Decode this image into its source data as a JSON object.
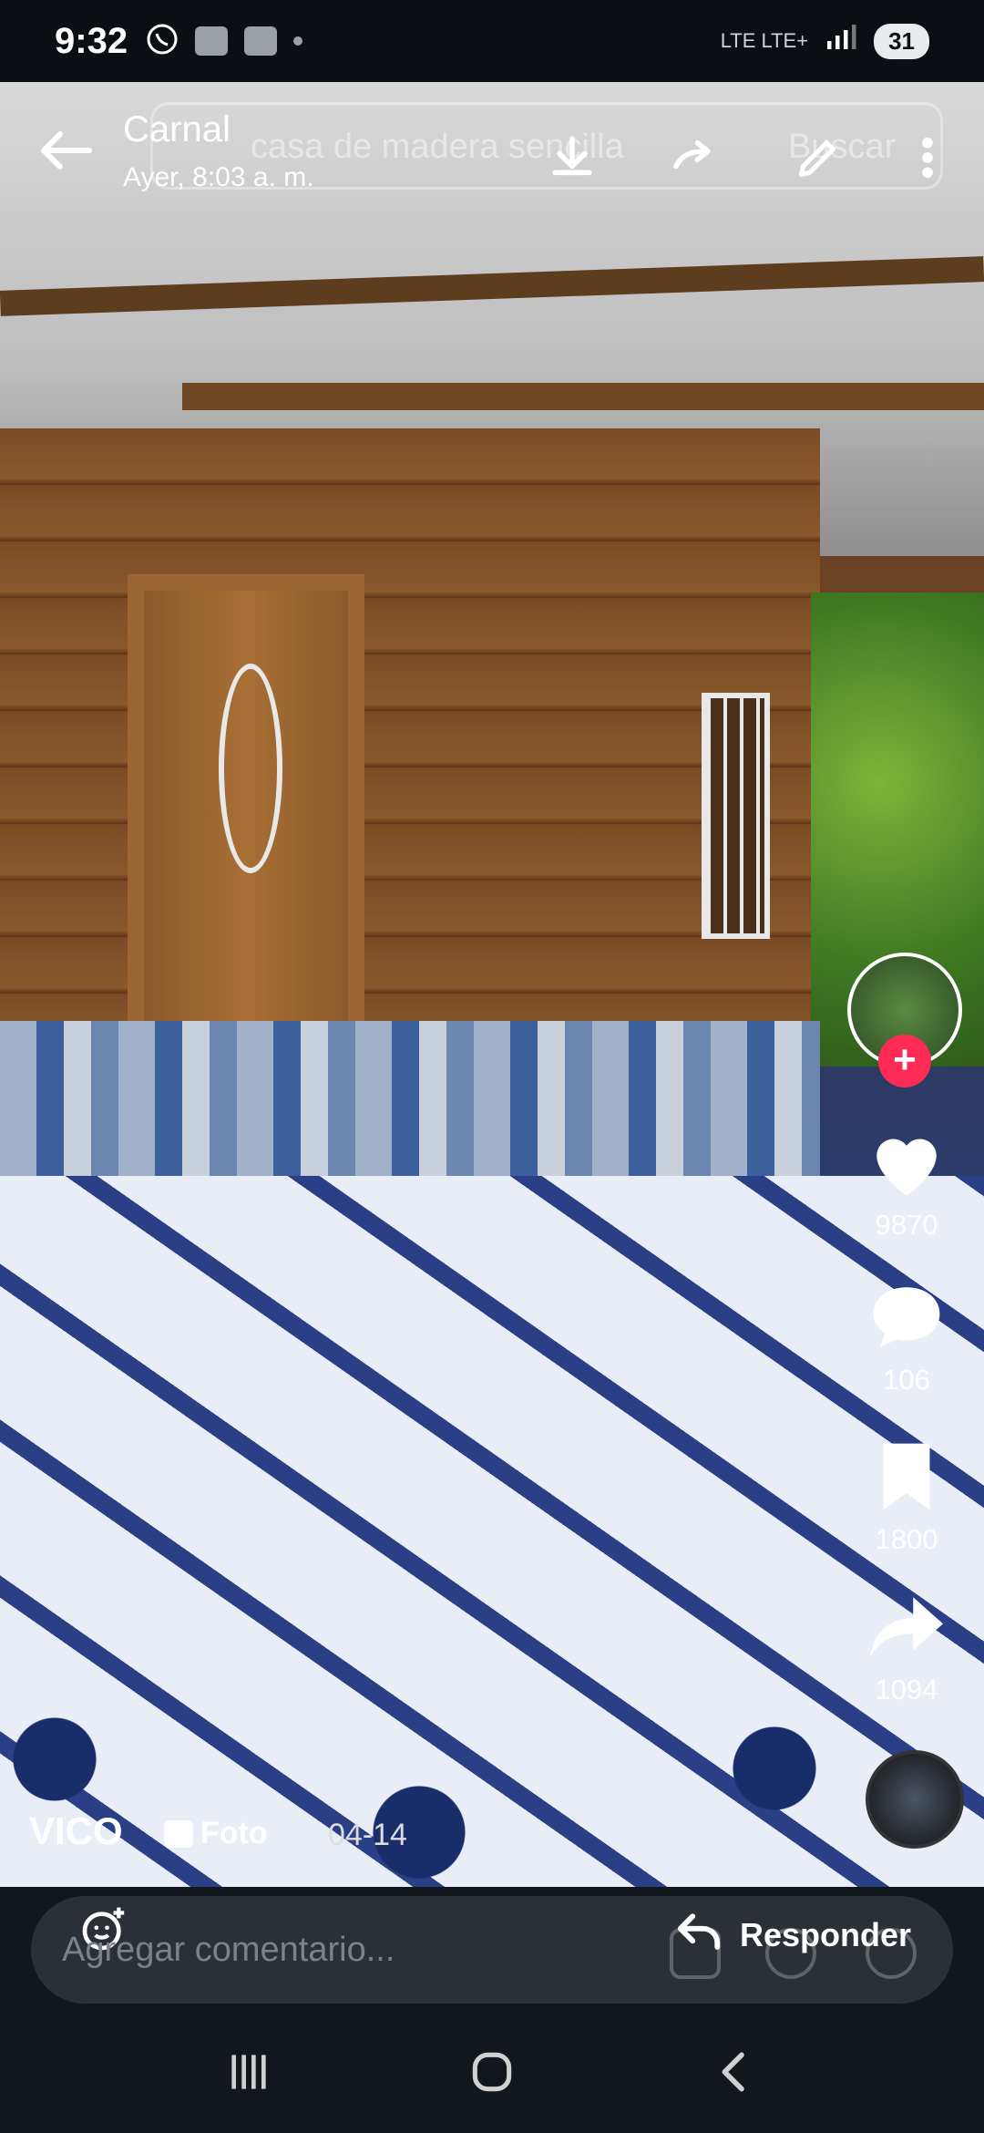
{
  "status_bar": {
    "time": "9:32",
    "network": "LTE LTE+",
    "battery": "31"
  },
  "header": {
    "title": "Carnal",
    "subtitle": "Ayer, 8:03 a. m.",
    "background_search_text": "casa de madera sencilla",
    "background_search_button": "Buscar"
  },
  "post": {
    "author": "VICO",
    "type_label": "Foto",
    "date": "04-14",
    "likes": "9870",
    "comments": "106",
    "saves": "1800",
    "shares": "1094"
  },
  "composer": {
    "placeholder": "Agregar comentario...",
    "reply_label": "Responder"
  },
  "colors": {
    "like_red": "#fe2c55",
    "background": "#0b0f14"
  }
}
